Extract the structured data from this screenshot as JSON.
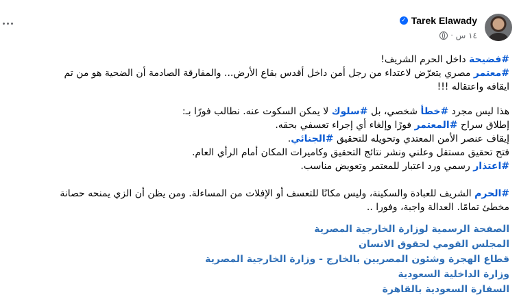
{
  "post": {
    "author": "Tarek Elawady",
    "time": "١٤ س",
    "lines_p1": [
      [
        {
          "tag": "#فضيحة"
        },
        {
          "text": " داخل الحرم الشريف!"
        }
      ],
      [
        {
          "tag": "#معتمر"
        },
        {
          "text": " مصري يتعرّض لاعتداء من رجل أمن داخل أقدس بقاع الأرض... والمفارقة الصادمة أن الضحية هو من تم"
        }
      ],
      [
        {
          "text": "ايقافه واعتقاله !!!"
        }
      ]
    ],
    "lines_p2": [
      [
        {
          "text": "هذا ليس مجرد "
        },
        {
          "tag": "#خطأ"
        },
        {
          "text": " شخصي، بل "
        },
        {
          "tag": "#سلوك"
        },
        {
          "text": " لا يمكن السكوت عنه. نطالب فورًا بـ:"
        }
      ],
      [
        {
          "text": "إطلاق سراح "
        },
        {
          "tag": "#المعتمر"
        },
        {
          "text": " فورًا وإلغاء أي إجراء تعسفي بحقه."
        }
      ],
      [
        {
          "text": "إيقاف عنصر الأمن المعتدي وتحويله للتحقيق "
        },
        {
          "tag": "#الجنائي"
        },
        {
          "text": "."
        }
      ],
      [
        {
          "text": "فتح تحقيق مستقل وعلني ونشر نتائج التحقيق وكاميرات المكان أمام الرأي العام."
        }
      ],
      [
        {
          "tag": "#اعتذار"
        },
        {
          "text": " رسمي ورد اعتبار للمعتمر وتعويض مناسب."
        }
      ]
    ],
    "lines_p3": [
      [
        {
          "tag": "#الحرم"
        },
        {
          "text": " الشريف  للعبادة والسكينة، وليس مكانًا للتعسف أو الإفلات من المساءلة. ومن يظن أن الزي يمنحه حصانة"
        }
      ],
      [
        {
          "text": "مخطئ تمامًا. العدالة واجبة، وفورا .."
        }
      ]
    ],
    "links": [
      "الصفحة الرسمية لوزارة الخارجية المصرية",
      "المجلس القومي لحقوق الانسان",
      "قطاع الهجرة وشئون المصريين بالخارج - وزارة الخارجية المصرية",
      "وزارة الداخلية السعودية",
      "السفارة السعودية بالقاهرة"
    ]
  }
}
